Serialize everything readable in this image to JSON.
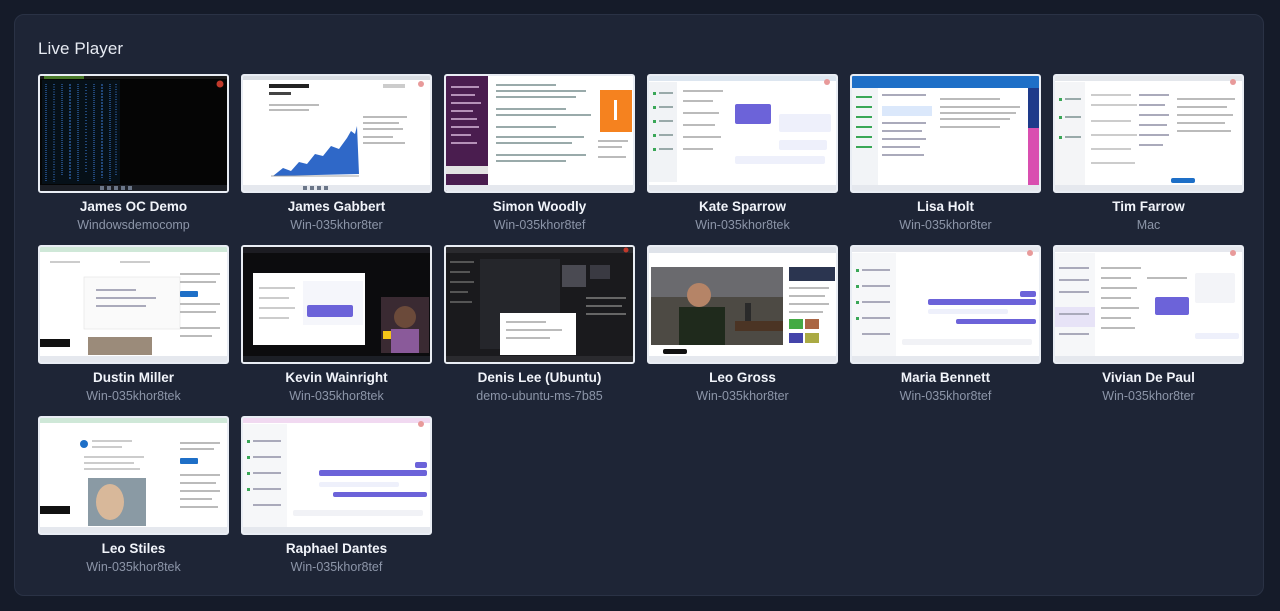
{
  "panel": {
    "title": "Live Player"
  },
  "sessions": [
    {
      "name": "James OC Demo",
      "host": "Windowsdemocomp",
      "thumb": "terminal-desktop"
    },
    {
      "name": "James Gabbert",
      "host": "Win-035khor8ter",
      "thumb": "stock-chart-desktop"
    },
    {
      "name": "Simon Woodly",
      "host": "Win-035khor8tef",
      "thumb": "slack-desktop"
    },
    {
      "name": "Kate Sparrow",
      "host": "Win-035khor8tek",
      "thumb": "chat-app-desktop"
    },
    {
      "name": "Lisa Holt",
      "host": "Win-035khor8ter",
      "thumb": "email-client-desktop"
    },
    {
      "name": "Tim Farrow",
      "host": "Mac",
      "thumb": "spreadsheet-desktop"
    },
    {
      "name": "Dustin Miller",
      "host": "Win-035khor8tek",
      "thumb": "social-feed-desktop"
    },
    {
      "name": "Kevin Wainright",
      "host": "Win-035khor8tek",
      "thumb": "video-call-desktop"
    },
    {
      "name": "Denis Lee (Ubuntu)",
      "host": "demo-ubuntu-ms-7b85",
      "thumb": "dark-ide-desktop"
    },
    {
      "name": "Leo Gross",
      "host": "Win-035khor8ter",
      "thumb": "video-player-desktop"
    },
    {
      "name": "Maria Bennett",
      "host": "Win-035khor8tef",
      "thumb": "chat-app-desktop"
    },
    {
      "name": "Vivian De Paul",
      "host": "Win-035khor8ter",
      "thumb": "chat-app-desktop"
    },
    {
      "name": "Leo Stiles",
      "host": "Win-035khor8tek",
      "thumb": "social-photo-desktop"
    },
    {
      "name": "Raphael Dantes",
      "host": "Win-035khor8tef",
      "thumb": "chat-app-desktop"
    }
  ]
}
